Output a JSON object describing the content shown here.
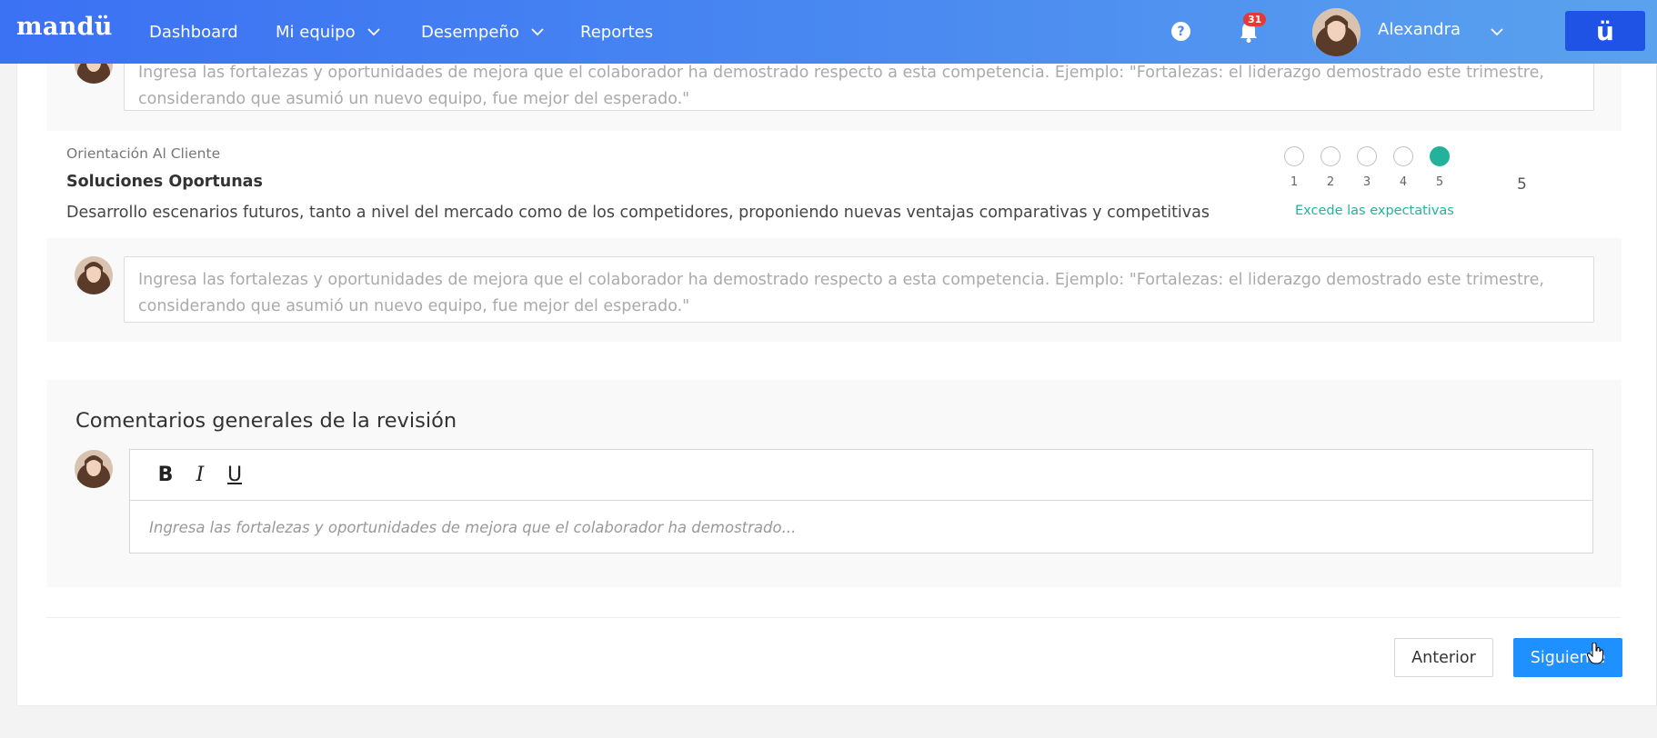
{
  "brand": {
    "logo": "mandü",
    "logo_button": "ü"
  },
  "nav": {
    "dashboard": "Dashboard",
    "team": "Mi equipo",
    "performance": "Desempeño",
    "reports": "Reportes"
  },
  "header": {
    "help": "?",
    "notifications_count": "31",
    "user_name": "Alexandra"
  },
  "comment_placeholder": "Ingresa las fortalezas y oportunidades de mejora que el colaborador ha demostrado respecto a esta competencia. Ejemplo: \"Fortalezas: el liderazgo demostrado este trimestre, considerando que asumió un nuevo equipo, fue mejor del esperado.\"",
  "competency": {
    "category": "Orientación Al Cliente",
    "title": "Soluciones Oportunas",
    "description": "Desarrollo escenarios futuros, tanto a nivel del mercado como de los competidores, proponiendo nuevas ventajas comparativas y competitivas",
    "rating_options": [
      "1",
      "2",
      "3",
      "4",
      "5"
    ],
    "selected_rating": 5,
    "rating_label": "Excede las expectativas",
    "rating_value": "5"
  },
  "general": {
    "title": "Comentarios generales de la revisión",
    "toolbar": {
      "bold": "B",
      "italic": "I",
      "underline": "U"
    },
    "placeholder": "Ingresa las fortalezas y oportunidades de mejora que el colaborador ha demostrado..."
  },
  "footer": {
    "prev_label": "Anterior",
    "next_label": "Siguiente"
  },
  "colors": {
    "accent": "#1e90ff",
    "rating_selected": "#23b39a",
    "nav_gradient_start": "#3b71f3",
    "nav_gradient_end": "#5aa2ee"
  }
}
